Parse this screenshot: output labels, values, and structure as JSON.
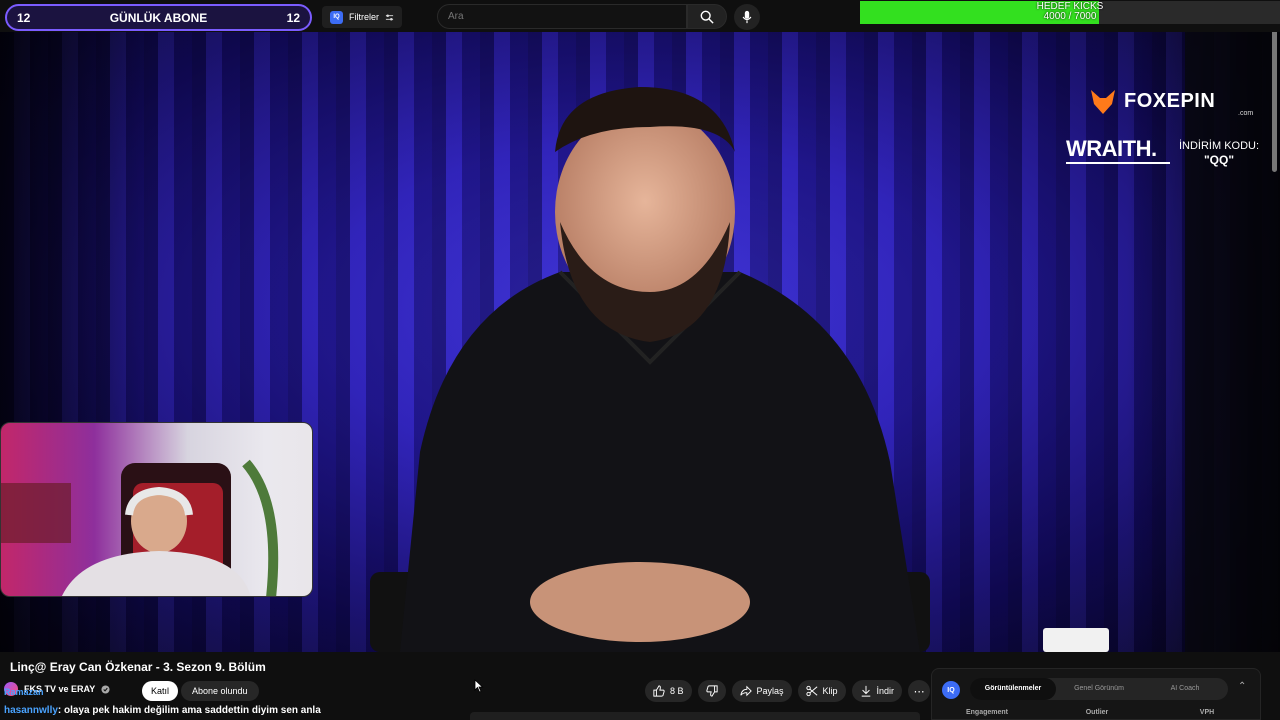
{
  "topbar": {
    "sub_goal": {
      "left_count": "12",
      "label": "GÜNLÜK ABONE",
      "right_count": "12"
    },
    "filters_label": "Filtreler",
    "iq_badge": "IQ",
    "search_placeholder": "Ara",
    "kick_goal": {
      "title": "HEDEF KICKS",
      "progress_text": "4000 / 7000",
      "progress_fraction": 0.57,
      "color": "#33e01f"
    }
  },
  "overlays": {
    "foxepin": {
      "word": "FOXEPIN",
      "domain": ".com",
      "accent": "#ff7a1a"
    },
    "wraith": "WRAITH.",
    "promo_line": "İNDİRİM KODU:",
    "promo_code": "\"QQ\""
  },
  "video": {
    "title": "Linç@ Eray Can Özkenar - 3. Sezon 9. Bölüm",
    "channel": "FKS TV ve ERAY",
    "join_label": "Katıl",
    "subscribed_label": "Abone olundu",
    "actions": {
      "like": "8 B",
      "share": "Paylaş",
      "clip": "Klip",
      "download": "İndir"
    }
  },
  "chat": {
    "line1_user": "Ramazan",
    "line2_user": "hasannwlly",
    "line2_text": ": olaya pek hakim değilim ama saddettin diyim sen anla"
  },
  "iq_panel": {
    "logo": "IQ",
    "tabs": [
      "Görüntülenmeler",
      "Genel Görünüm",
      "AI Coach"
    ],
    "columns": [
      "Engagement",
      "Outlier",
      "VPH"
    ]
  }
}
